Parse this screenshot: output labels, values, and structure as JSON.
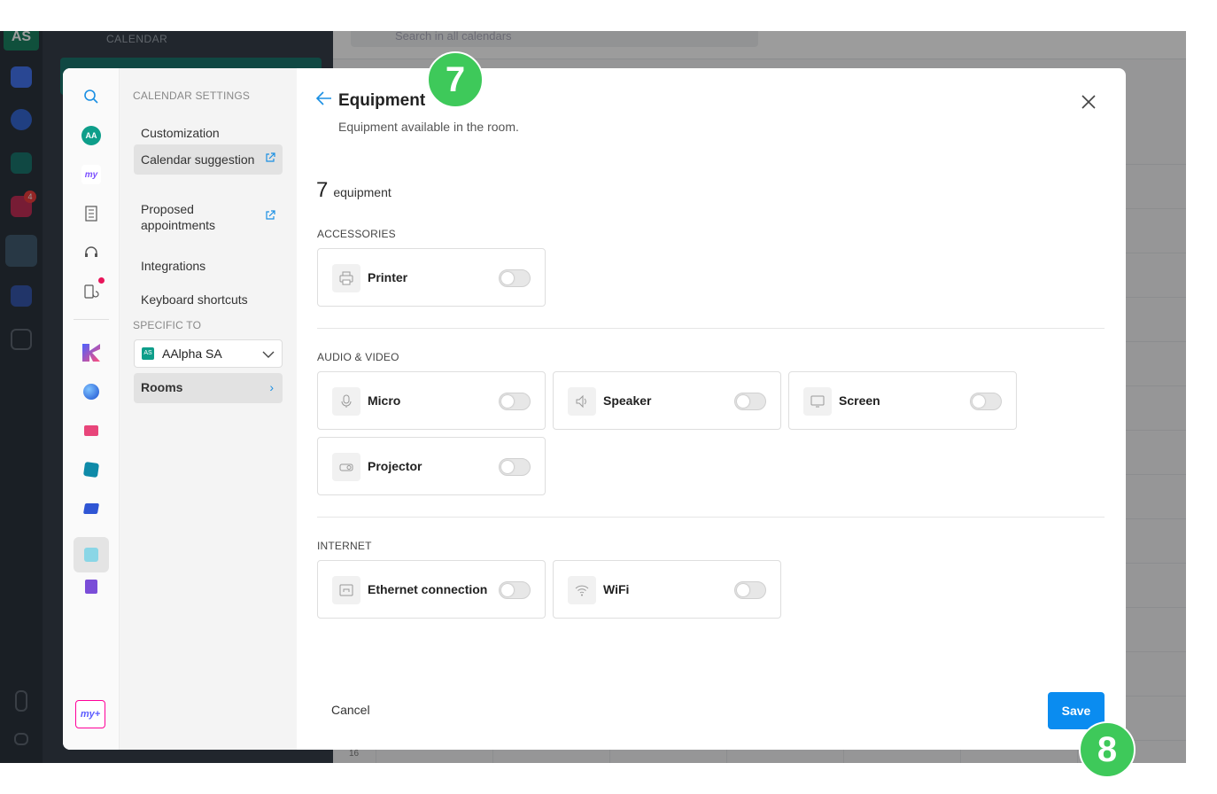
{
  "background": {
    "brand": "CALENDAR",
    "avatar": "AS",
    "search_placeholder": "Search in all calendars",
    "row_number": "16",
    "notification_count": "4"
  },
  "settings_nav": {
    "heading": "CALENDAR SETTINGS",
    "items": [
      {
        "label": "Customization",
        "external": false
      },
      {
        "label": "Calendar suggestion",
        "external": true,
        "active": true
      },
      {
        "label": "Proposed appointments",
        "external": true
      },
      {
        "label": "Integrations",
        "external": false
      },
      {
        "label": "Keyboard shortcuts",
        "external": false
      }
    ],
    "specific_heading": "SPECIFIC TO",
    "org": {
      "badge": "AS",
      "name": "AAlpha SA"
    },
    "rooms_label": "Rooms"
  },
  "icon_col": {
    "avatar": "AA",
    "brand_label": "my",
    "bottom_label": "my+"
  },
  "equipment": {
    "title": "Equipment",
    "subtitle": "Equipment available in the room.",
    "count": "7",
    "count_label": "equipment",
    "sections": [
      {
        "title": "ACCESSORIES",
        "items": [
          {
            "label": "Printer",
            "icon": "printer-icon",
            "enabled": false
          }
        ]
      },
      {
        "title": "AUDIO & VIDEO",
        "items": [
          {
            "label": "Micro",
            "icon": "microphone-icon",
            "enabled": false
          },
          {
            "label": "Speaker",
            "icon": "speaker-icon",
            "enabled": false
          },
          {
            "label": "Screen",
            "icon": "monitor-icon",
            "enabled": false
          },
          {
            "label": "Projector",
            "icon": "projector-icon",
            "enabled": false
          }
        ]
      },
      {
        "title": "INTERNET",
        "items": [
          {
            "label": "Ethernet connection",
            "icon": "ethernet-icon",
            "enabled": false
          },
          {
            "label": "WiFi",
            "icon": "wifi-icon",
            "enabled": false
          }
        ]
      }
    ],
    "cancel_label": "Cancel",
    "save_label": "Save"
  },
  "badges": {
    "step_a": "7",
    "step_b": "8",
    "color": "#3ec95a"
  },
  "colors": {
    "accent": "#0a8cf0",
    "link": "#1a8fe3",
    "toggle_off": "#e7e7e7"
  }
}
